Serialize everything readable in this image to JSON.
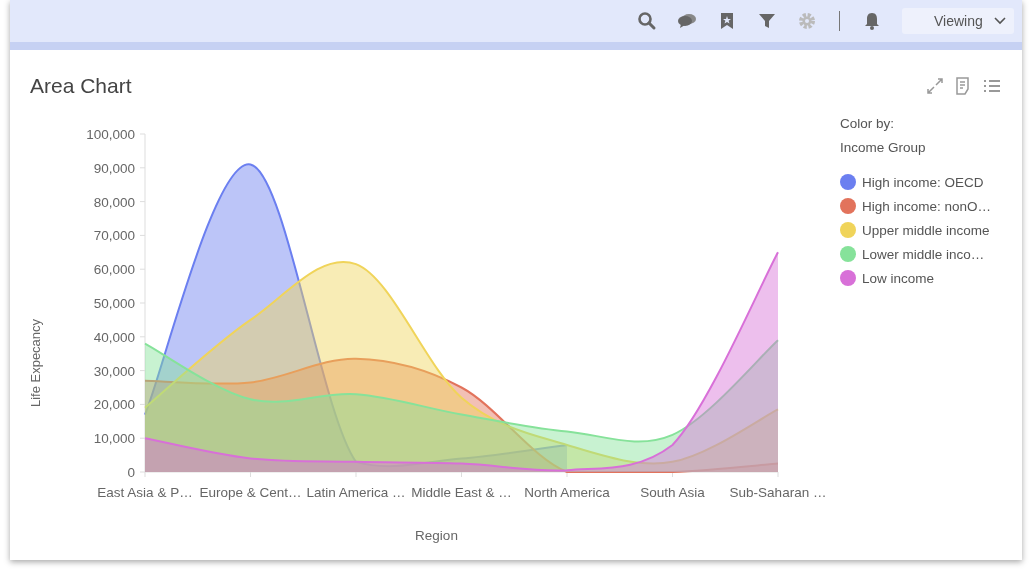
{
  "toolbar": {
    "view_mode": "Viewing"
  },
  "card": {
    "title": "Area Chart",
    "chart_data": {
      "type": "area",
      "xlabel": "Region",
      "ylabel": "Life Expecancy",
      "categories": [
        "East Asia & P…",
        "Europe & Cent…",
        "Latin America …",
        "Middle East & …",
        "North America",
        "South Asia",
        "Sub-Saharan …"
      ],
      "ylim": [
        0,
        100000
      ],
      "yticks": [
        {
          "value": 0,
          "label": "0"
        },
        {
          "value": 10000,
          "label": "10,000"
        },
        {
          "value": 20000,
          "label": "20,000"
        },
        {
          "value": 30000,
          "label": "30,000"
        },
        {
          "value": 40000,
          "label": "40,000"
        },
        {
          "value": 50000,
          "label": "50,000"
        },
        {
          "value": 60000,
          "label": "60,000"
        },
        {
          "value": 70000,
          "label": "70,000"
        },
        {
          "value": 80000,
          "label": "80,000"
        },
        {
          "value": 90000,
          "label": "90,000"
        },
        {
          "value": 100000,
          "label": "100,000"
        }
      ],
      "series": [
        {
          "name": "High income: OECD",
          "color": "#6b7ff0",
          "values": [
            17000,
            91000,
            3000,
            4000,
            8000,
            null,
            null
          ]
        },
        {
          "name": "High income: nonO…",
          "color": "#e2735c",
          "values": [
            27000,
            26500,
            33500,
            25000,
            0,
            0,
            2500
          ]
        },
        {
          "name": "Upper middle income",
          "color": "#f0d45a",
          "values": [
            19000,
            45000,
            61500,
            22000,
            8000,
            3000,
            18500
          ]
        },
        {
          "name": "Lower middle inco…",
          "color": "#86e29a",
          "values": [
            38000,
            21500,
            23000,
            17000,
            12000,
            11000,
            39000
          ]
        },
        {
          "name": "Low income",
          "color": "#d870d8",
          "values": [
            10000,
            4000,
            3000,
            2500,
            500,
            8000,
            65000
          ]
        }
      ]
    },
    "legend": {
      "title": "Color by:",
      "field": "Income Group"
    }
  }
}
